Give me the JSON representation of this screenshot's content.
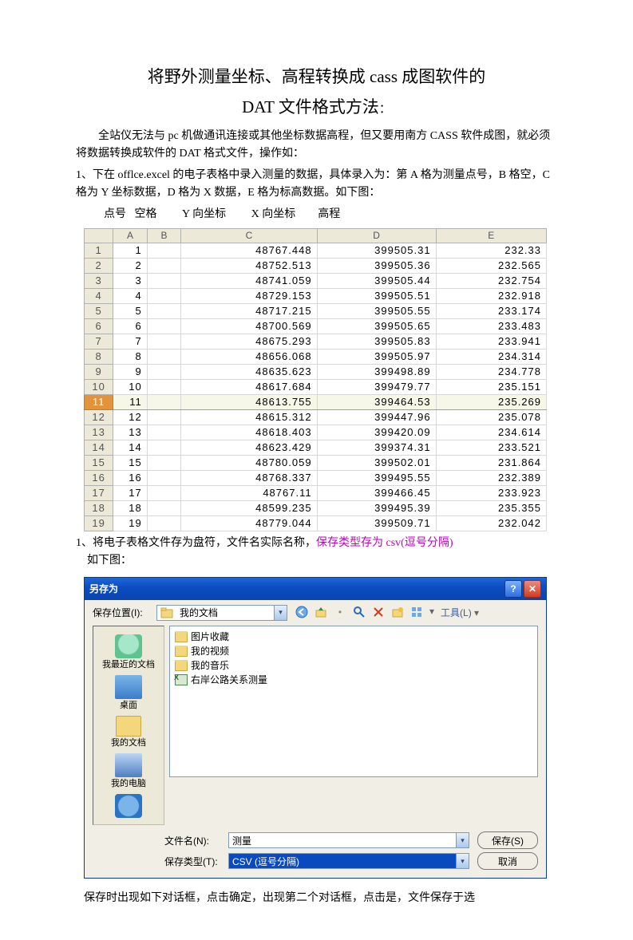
{
  "title_line1": "将野外测量坐标、高程转换成 cass 成图软件的",
  "title_line2": "DAT 文件格式方法",
  "title_colon": "：",
  "p1": "全站仪无法与 pc 机做通讯连接或其他坐标数据高程，但又要用南方 CASS 软件成图，就必须将数据转换成软件的 DAT 格式文件，操作如：",
  "p2": "1、下在 offlce.excel 的电子表格中录入测量的数据，具体录入为：第 A 格为测量点号，B 格空，C 格为 Y 坐标数据，D 格为 X 数据，E 格为标高数据。如下图：",
  "cols_label": "          点号   空格         Y 向坐标         X 向坐标        高程",
  "excel": {
    "headers": [
      "",
      "A",
      "B",
      "C",
      "D",
      "E"
    ],
    "rows": [
      {
        "n": "1",
        "a": "1",
        "c": "48767.448",
        "d": "399505.31",
        "e": "232.33"
      },
      {
        "n": "2",
        "a": "2",
        "c": "48752.513",
        "d": "399505.36",
        "e": "232.565"
      },
      {
        "n": "3",
        "a": "3",
        "c": "48741.059",
        "d": "399505.44",
        "e": "232.754"
      },
      {
        "n": "4",
        "a": "4",
        "c": "48729.153",
        "d": "399505.51",
        "e": "232.918"
      },
      {
        "n": "5",
        "a": "5",
        "c": "48717.215",
        "d": "399505.55",
        "e": "233.174"
      },
      {
        "n": "6",
        "a": "6",
        "c": "48700.569",
        "d": "399505.65",
        "e": "233.483"
      },
      {
        "n": "7",
        "a": "7",
        "c": "48675.293",
        "d": "399505.83",
        "e": "233.941"
      },
      {
        "n": "8",
        "a": "8",
        "c": "48656.068",
        "d": "399505.97",
        "e": "234.314"
      },
      {
        "n": "9",
        "a": "9",
        "c": "48635.623",
        "d": "399498.89",
        "e": "234.778"
      },
      {
        "n": "10",
        "a": "10",
        "c": "48617.684",
        "d": "399479.77",
        "e": "235.151"
      },
      {
        "n": "11",
        "a": "11",
        "c": "48613.755",
        "d": "399464.53",
        "e": "235.269",
        "sel": true
      },
      {
        "n": "12",
        "a": "12",
        "c": "48615.312",
        "d": "399447.96",
        "e": "235.078"
      },
      {
        "n": "13",
        "a": "13",
        "c": "48618.403",
        "d": "399420.09",
        "e": "234.614"
      },
      {
        "n": "14",
        "a": "14",
        "c": "48623.429",
        "d": "399374.31",
        "e": "233.521"
      },
      {
        "n": "15",
        "a": "15",
        "c": "48780.059",
        "d": "399502.01",
        "e": "231.864"
      },
      {
        "n": "16",
        "a": "16",
        "c": "48768.337",
        "d": "399495.55",
        "e": "232.389"
      },
      {
        "n": "17",
        "a": "17",
        "c": "48767.11",
        "d": "399466.45",
        "e": "233.923"
      },
      {
        "n": "18",
        "a": "18",
        "c": "48599.235",
        "d": "399495.39",
        "e": "235.355"
      },
      {
        "n": "19",
        "a": "19",
        "c": "48779.044",
        "d": "399509.71",
        "e": "232.042"
      }
    ]
  },
  "p3_prefix": "1、将电子表格文件存为盘符，文件名实际名称，",
  "p3_magenta": "保存类型存为 csv(逗号分隔)",
  "p3_suffix": "    如下图：",
  "saveas": {
    "title": "另存为",
    "help": "?",
    "close": "✕",
    "savein_label": "保存位置(I):",
    "savein_value": "我的文档",
    "tools_label": "工具(L)",
    "places": {
      "recent": "我最近的文档",
      "desktop": "桌面",
      "mydocs": "我的文档",
      "mypc": "我的电脑",
      "network": ""
    },
    "files": [
      {
        "icon": "folder",
        "name": "图片收藏"
      },
      {
        "icon": "folder",
        "name": "我的视频"
      },
      {
        "icon": "folder",
        "name": "我的音乐"
      },
      {
        "icon": "xls",
        "name": "右岸公路关系测量"
      }
    ],
    "filename_label": "文件名(N):",
    "filename_value": "测量",
    "filetype_label": "保存类型(T):",
    "filetype_value": "CSV (逗号分隔)",
    "save_btn": "保存(S)",
    "cancel_btn": "取消"
  },
  "p4": "保存时出现如下对话框，点击确定，出现第二个对话框，点击是，文件保存于选"
}
